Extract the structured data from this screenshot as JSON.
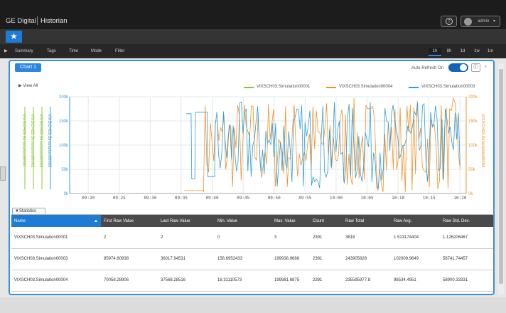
{
  "header": {
    "brand": "GE Digital",
    "app_title": "Historian",
    "help_label": "?",
    "user_name": "admin",
    "user_chevron": "▾"
  },
  "favorites": {
    "star_icon": "★"
  },
  "menu": {
    "expand_icon": "▶",
    "items": [
      "Summary",
      "Tags",
      "Time",
      "Mode",
      "Filter"
    ],
    "ranges": [
      "1h",
      "8h",
      "1d",
      "1w",
      "1m"
    ],
    "active_range": "1h"
  },
  "panel": {
    "chart_tab": "Chart 1",
    "auto_refresh_label": "Auto-Refresh On",
    "auto_refresh_on": true,
    "info_label": "ⓘ",
    "close_label": "×",
    "view_all_label": "▶  View All"
  },
  "colors": {
    "series1": "#8cc43c",
    "series2": "#f0922b",
    "series3": "#2f9ed8",
    "accent": "#2a86df"
  },
  "chart_data": {
    "type": "line",
    "series": [
      {
        "name": "VIXSCH03.Simulation00001",
        "color": "#8cc43c",
        "axis": "left-1",
        "ylim": [
          0,
          3
        ]
      },
      {
        "name": "VIXSCH03.Simulation00004",
        "color": "#f0922b",
        "axis": "right",
        "ylim": [
          0,
          200000
        ]
      },
      {
        "name": "VIXSCH03.Simulation00003",
        "color": "#2f9ed8",
        "axis": "left-3",
        "ylim": [
          0,
          200000
        ]
      }
    ],
    "left_axis_names": [
      "VIXSCH03.Simulation00001",
      "VIXSCH03.Simulation00003",
      "VIXSCH03.Simulation00003"
    ],
    "right_axis_name": "VIXSCH03.Simulation00004",
    "y_ticks_left": [
      "200k",
      "150k",
      "100k",
      "50k",
      "0k"
    ],
    "y_ticks_right": [
      "200k",
      "150k",
      "100k",
      "50k",
      "0k"
    ],
    "x_ticks": [
      "09:20",
      "09:25",
      "09:30",
      "09:35",
      "09:40",
      "09:45",
      "09:50",
      "09:55",
      "10:00",
      "10:05",
      "10:10",
      "10:15",
      "10:20"
    ],
    "x_range": [
      "09:17",
      "10:21"
    ],
    "ylim": [
      0,
      200000
    ],
    "grid": true,
    "legend_position": "top"
  },
  "stats": {
    "tab_label": "▼Statistics",
    "headers": [
      "Name",
      "First Raw Value",
      "Last Raw Value",
      "Min. Value",
      "Max. Value",
      "Count",
      "Raw Total",
      "Raw Avg.",
      "Raw Std. Dev."
    ],
    "sort_icon": "▲",
    "rows": [
      [
        "VIXSCH03.Simulation00001",
        "2",
        "2",
        "0",
        "3",
        "2391",
        "3618",
        "1.513174404",
        "1.126206467"
      ],
      [
        "VIXSCH03.Simulation00003",
        "95974.60938",
        "36017.94531",
        "158.6952433",
        "199938.9688",
        "2391",
        "243905826",
        "102009.9649",
        "56741.74457"
      ],
      [
        "VIXSCH03.Simulation00004",
        "70058.28906",
        "37568.28516",
        "18.31110573",
        "199981.6875",
        "2391",
        "235595977.8",
        "98534.4951",
        "58900.33331"
      ]
    ]
  }
}
